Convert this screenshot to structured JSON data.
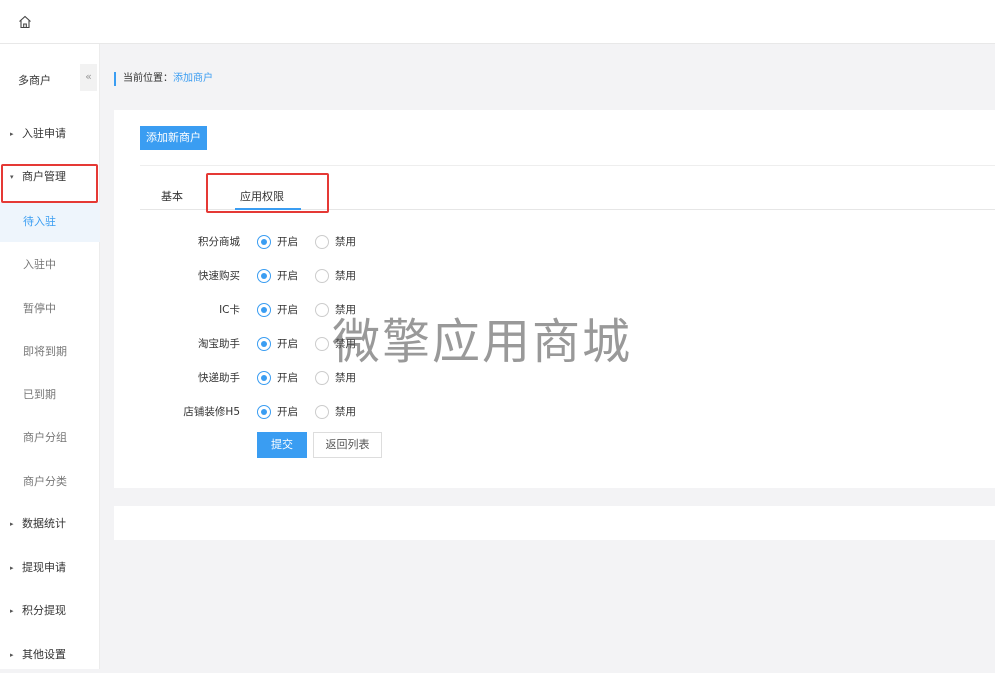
{
  "topbar": {
    "home_icon": "home-icon"
  },
  "sidebar": {
    "title": "多商户",
    "collapse_glyph": "«",
    "items": [
      {
        "label": "入驻申请",
        "caret": "▸"
      },
      {
        "label": "商户管理",
        "caret": "▾"
      },
      {
        "label": "数据统计",
        "caret": "▸"
      },
      {
        "label": "提现申请",
        "caret": "▸"
      },
      {
        "label": "积分提现",
        "caret": "▸"
      },
      {
        "label": "其他设置",
        "caret": "▸"
      }
    ],
    "subitems": [
      {
        "label": "待入驻",
        "active": true
      },
      {
        "label": "入驻中"
      },
      {
        "label": "暂停中"
      },
      {
        "label": "即将到期"
      },
      {
        "label": "已到期"
      },
      {
        "label": "商户分组"
      },
      {
        "label": "商户分类"
      }
    ]
  },
  "breadcrumb": {
    "prefix": "当前位置：",
    "current": "添加商户"
  },
  "main": {
    "add_button": "添加新商户",
    "tabs": [
      {
        "label": "基本"
      },
      {
        "label": "应用权限",
        "active": true
      }
    ],
    "permissions": [
      {
        "label": "积分商城",
        "on": "开启",
        "off": "禁用",
        "value": "开启"
      },
      {
        "label": "快速购买",
        "on": "开启",
        "off": "禁用",
        "value": "开启"
      },
      {
        "label": "IC卡",
        "on": "开启",
        "off": "禁用",
        "value": "开启"
      },
      {
        "label": "淘宝助手",
        "on": "开启",
        "off": "禁用",
        "value": "开启"
      },
      {
        "label": "快递助手",
        "on": "开启",
        "off": "禁用",
        "value": "开启"
      },
      {
        "label": "店铺装修H5",
        "on": "开启",
        "off": "禁用",
        "value": "开启"
      }
    ],
    "submit_label": "提交",
    "back_label": "返回列表"
  },
  "watermark": "微擎应用商城",
  "colors": {
    "accent": "#3a9df2",
    "highlight_box": "#e53935"
  }
}
